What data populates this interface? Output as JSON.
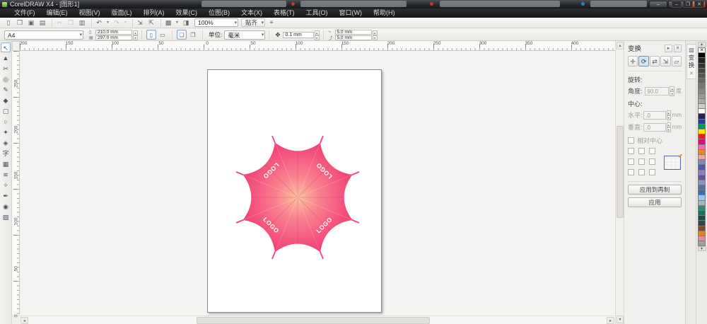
{
  "window": {
    "title": "CorelDRAW X4 - [图形1]"
  },
  "icons": {
    "minimize": "–",
    "maximize": "▢",
    "close": "✕",
    "doc_minimize": "‒",
    "doc_restore": "❐",
    "doc_close": "✕"
  },
  "menu": {
    "items": [
      "文件(F)",
      "编辑(E)",
      "视图(V)",
      "版面(L)",
      "排列(A)",
      "效果(C)",
      "位图(B)",
      "文本(X)",
      "表格(T)",
      "工具(O)",
      "窗口(W)",
      "帮助(H)"
    ]
  },
  "toolbar": {
    "zoom_value": "100%",
    "snap_label": "贴齐",
    "buttons": [
      {
        "n": "new-button",
        "g": "▯"
      },
      {
        "n": "open-button",
        "g": "❒"
      },
      {
        "n": "save-button",
        "g": "▣"
      },
      {
        "n": "print-button",
        "g": "▤"
      },
      {
        "n": "separator",
        "g": "",
        "cls": "sep"
      },
      {
        "n": "cut-button",
        "g": "✂",
        "cls": "dim"
      },
      {
        "n": "copy-button",
        "g": "❐",
        "cls": "dim"
      },
      {
        "n": "paste-button",
        "g": "▥"
      },
      {
        "n": "separator",
        "g": "",
        "cls": "sep"
      },
      {
        "n": "undo-button",
        "g": "↶"
      },
      {
        "n": "undo-dropdown",
        "g": "▾",
        "cls": "drop"
      },
      {
        "n": "redo-button",
        "g": "↷",
        "cls": "dim"
      },
      {
        "n": "redo-dropdown",
        "g": "▾",
        "cls": "drop dim"
      },
      {
        "n": "separator",
        "g": "",
        "cls": "sep"
      },
      {
        "n": "import-button",
        "g": "⇲"
      },
      {
        "n": "export-button",
        "g": "⇱"
      },
      {
        "n": "separator",
        "g": "",
        "cls": "sep"
      },
      {
        "n": "app-launcher-button",
        "g": "▩"
      },
      {
        "n": "launcher-dropdown",
        "g": "▾",
        "cls": "drop"
      },
      {
        "n": "welcome-screen-button",
        "g": "◨"
      }
    ]
  },
  "property_bar": {
    "preset": "A4",
    "page_width": "210.0 mm",
    "page_height": "297.0 mm",
    "units_label": "单位:",
    "units_value": "毫米",
    "nudge_value": "0.1 mm",
    "duplicate_x": "5.0 mm",
    "duplicate_y": "5.0 mm"
  },
  "rulers": {
    "h_labels": [
      "200",
      "150",
      "100",
      "50",
      "0",
      "50",
      "100",
      "150",
      "200",
      "250",
      "300",
      "350",
      "400"
    ],
    "v_labels": [
      "250",
      "200",
      "150",
      "100",
      "50",
      "0"
    ]
  },
  "toolbox": {
    "tools": [
      {
        "n": "pick-tool",
        "g": "↖",
        "cls": "active"
      },
      {
        "n": "shape-tool",
        "g": "▲"
      },
      {
        "n": "crop-tool",
        "g": "✂"
      },
      {
        "n": "zoom-tool",
        "g": "◎"
      },
      {
        "n": "freehand-tool",
        "g": "✎"
      },
      {
        "n": "smart-fill-tool",
        "g": "◆"
      },
      {
        "n": "rectangle-tool",
        "g": "▢"
      },
      {
        "n": "ellipse-tool",
        "g": "○"
      },
      {
        "n": "polygon-tool",
        "g": "✦"
      },
      {
        "n": "basic-shapes-tool",
        "g": "◈"
      },
      {
        "n": "text-tool",
        "g": "字"
      },
      {
        "n": "table-tool",
        "g": "▦"
      },
      {
        "n": "interactive-blend-tool",
        "g": "≋"
      },
      {
        "n": "eyedropper-tool",
        "g": "✧"
      },
      {
        "n": "outline-tool",
        "g": "✒"
      },
      {
        "n": "fill-tool",
        "g": "◉"
      },
      {
        "n": "interactive-fill-tool",
        "g": "▨"
      }
    ]
  },
  "docker": {
    "title": "变换",
    "flyout_glyph": "▸",
    "close_glyph": "✕",
    "modes": [
      {
        "n": "position-mode-button",
        "g": "✛"
      },
      {
        "n": "rotate-mode-button",
        "g": "⟳",
        "cls": "active"
      },
      {
        "n": "scale-mirror-mode-button",
        "g": "⇄"
      },
      {
        "n": "size-mode-button",
        "g": "⇲"
      },
      {
        "n": "skew-mode-button",
        "g": "▱"
      }
    ],
    "rotation_label": "旋转:",
    "angle_label": "角度:",
    "angle_value": "90.0",
    "angle_unit": "度",
    "center_label": "中心:",
    "horizontal_label": "水平:",
    "horizontal_value": ".0",
    "vertical_label": "垂直:",
    "vertical_value": ".0",
    "mm_unit": "mm",
    "relative_center_label": "相对中心",
    "apply_duplicate_label": "应用到再制",
    "apply_label": "应用",
    "vertical_tab": "变换"
  },
  "palette": {
    "none_glyph": "✕",
    "colors": [
      "#000000",
      "#222222",
      "#333333",
      "#444444",
      "#555555",
      "#666666",
      "#777777",
      "#888888",
      "#999999",
      "#aaaaaa",
      "#cccccc",
      "#ffffff",
      "#232063",
      "#2b3b9e",
      "#009a4e",
      "#ffe800",
      "#ed1c24",
      "#e5097f",
      "#ef6ea8",
      "#f58220",
      "#f4a68b",
      "#7d88c4",
      "#4f58a5",
      "#8b80c0",
      "#64519f",
      "#9094b8",
      "#5b6f9f",
      "#3f69b2",
      "#9fc6e9",
      "#aab2ba",
      "#2f8b79",
      "#206c5d",
      "#175043",
      "#39424a",
      "#7b4a2b",
      "#e08122",
      "#df8fa5",
      "#a0a0a0"
    ]
  },
  "umbrella": {
    "logo_text": "LOGO",
    "gradient": [
      "#FBBF9B",
      "#F8838E",
      "#F55880",
      "#F23A70"
    ]
  }
}
